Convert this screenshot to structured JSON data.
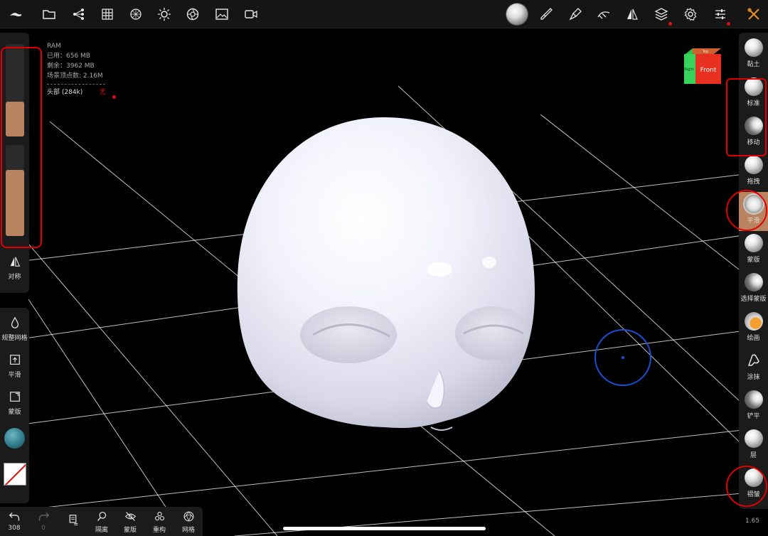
{
  "info": {
    "ram_label": "RAM",
    "used": "已用：656 MB",
    "free": "剩余：3962 MB",
    "vertices": "场景顶点数: 2.16M",
    "mesh_name": "头部 (284k)",
    "mesh_state": "无"
  },
  "left": {
    "symmetry_label": "对称",
    "remesh_label": "规整网格",
    "smooth_label": "平滑",
    "mask_label": "蒙版",
    "radius_fraction": 0.38,
    "intensity_fraction": 0.73
  },
  "bottom": {
    "undo_count": "308",
    "redo_count": "0",
    "isolate_label": "隔离",
    "mask_label": "蒙版",
    "rebuild_label": "重构",
    "mesh_label": "网格"
  },
  "tools": [
    {
      "label": "黏土",
      "style": "normal",
      "active": false
    },
    {
      "label": "标准",
      "style": "normal",
      "active": false
    },
    {
      "label": "移动",
      "style": "dark",
      "active": false
    },
    {
      "label": "拖拽",
      "style": "normal",
      "active": false
    },
    {
      "label": "平滑",
      "style": "fuzzy",
      "active": true
    },
    {
      "label": "蒙版",
      "style": "normal",
      "active": false
    },
    {
      "label": "选择蒙版",
      "style": "dark",
      "active": false
    },
    {
      "label": "绘画",
      "style": "orange",
      "active": false
    },
    {
      "label": "涂抹",
      "style": "outline",
      "active": false
    },
    {
      "label": "铲平",
      "style": "dark",
      "active": false
    },
    {
      "label": "层",
      "style": "normal",
      "active": false
    },
    {
      "label": "褶皱",
      "style": "normal",
      "active": false
    }
  ],
  "zoom": "1.65",
  "cube": {
    "front_label": "Front",
    "right_label": "Top",
    "side_label": "Right"
  },
  "colors": {
    "accent": "#b9835f",
    "annotation": "#e00000",
    "cursor": "#1a4fd8"
  }
}
